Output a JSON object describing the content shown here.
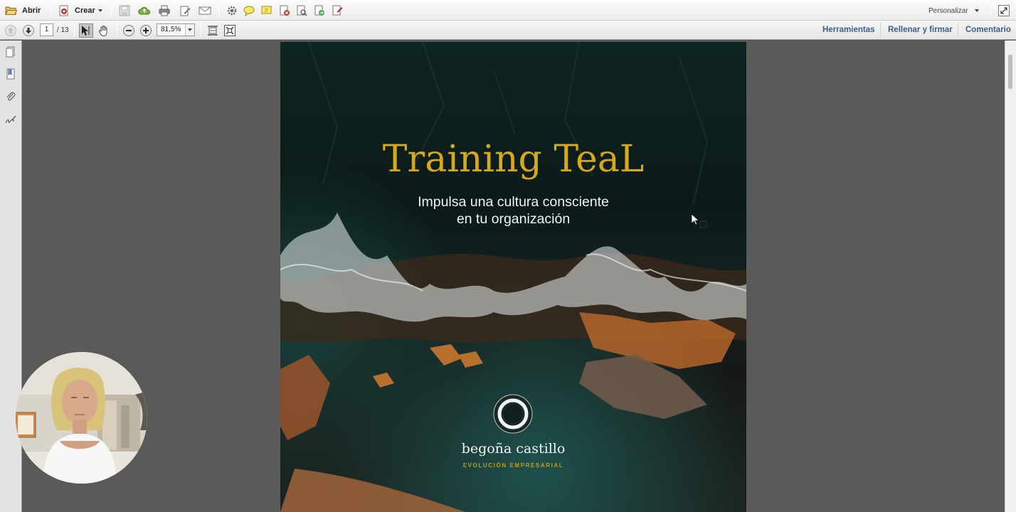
{
  "toolbar": {
    "open_label": "Abrir",
    "create_label": "Crear",
    "customize_label": "Personalizar"
  },
  "nav": {
    "current_page": "1",
    "total_pages": "/ 13",
    "zoom": "81,5%"
  },
  "panels": {
    "tools": "Herramientas",
    "fill_sign": "Rellenar y firmar",
    "comment": "Comentario"
  },
  "document": {
    "title": "Training TeaL",
    "subtitle_line1": "Impulsa una cultura consciente",
    "subtitle_line2": "en tu organización",
    "brand_name": "begoña castillo",
    "brand_tagline": "EVOLUCIÓN EMPRESARIAL"
  },
  "colors": {
    "title_gold": "#d6a81c",
    "link_blue": "#3c5d8c",
    "page_bg": "#0c1a18"
  }
}
